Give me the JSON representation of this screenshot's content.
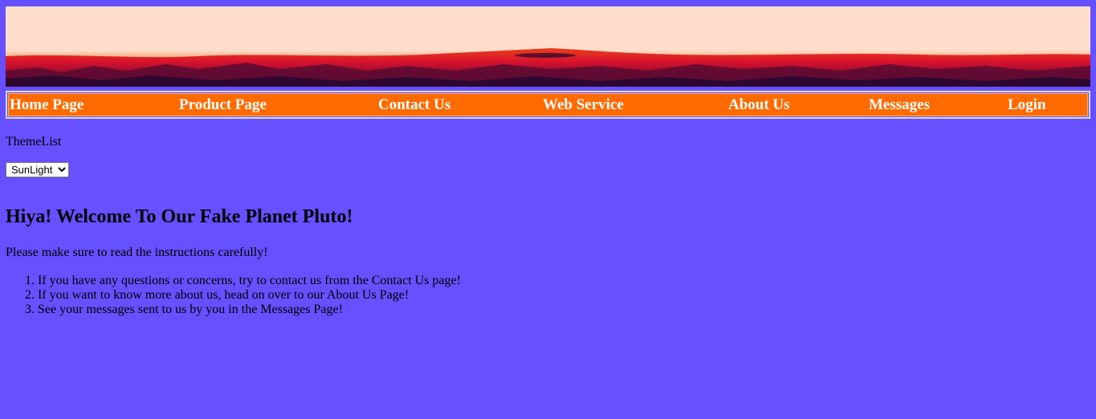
{
  "nav": {
    "items": [
      {
        "label": "Home Page"
      },
      {
        "label": "Product Page"
      },
      {
        "label": "Contact Us"
      },
      {
        "label": "Web Service"
      },
      {
        "label": "About Us"
      },
      {
        "label": "Messages"
      },
      {
        "label": "Login"
      }
    ]
  },
  "theme": {
    "label": "ThemeList",
    "selected": "SunLight"
  },
  "main": {
    "heading": "Hiya! Welcome To Our Fake Planet Pluto!",
    "intro": "Please make sure to read the instructions carefully!",
    "instructions": [
      "If you have any questions or concerns, try to contact us from the Contact Us page!",
      "If you want to know more about us, head on over to our About Us Page!",
      "See your messages sent to us by you in the Messages Page!"
    ]
  },
  "colors": {
    "background": "#6650FF",
    "nav_bar": "#FF6B00",
    "nav_text": "#FFFFFF"
  }
}
